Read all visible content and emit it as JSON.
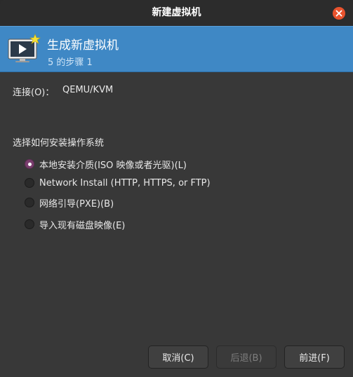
{
  "window": {
    "title": "新建虚拟机"
  },
  "banner": {
    "title": "生成新虚拟机",
    "subtitle": "5 的步骤 1",
    "icon": "monitor-play-star-icon"
  },
  "connection": {
    "label": "连接(O)：",
    "value": "QEMU/KVM"
  },
  "install": {
    "heading": "选择如何安装操作系统",
    "options": [
      {
        "label": "本地安装介质(ISO 映像或者光驱)(L)",
        "checked": true
      },
      {
        "label": "Network Install (HTTP, HTTPS, or FTP)",
        "checked": false
      },
      {
        "label": "网络引导(PXE)(B)",
        "checked": false
      },
      {
        "label": "导入现有磁盘映像(E)",
        "checked": false
      }
    ]
  },
  "buttons": {
    "cancel": "取消(C)",
    "back": "后退(B)",
    "forward": "前进(F)"
  },
  "colors": {
    "banner": "#3f88c5",
    "close": "#e9532e",
    "radio_checked": "#7a3e6e"
  }
}
